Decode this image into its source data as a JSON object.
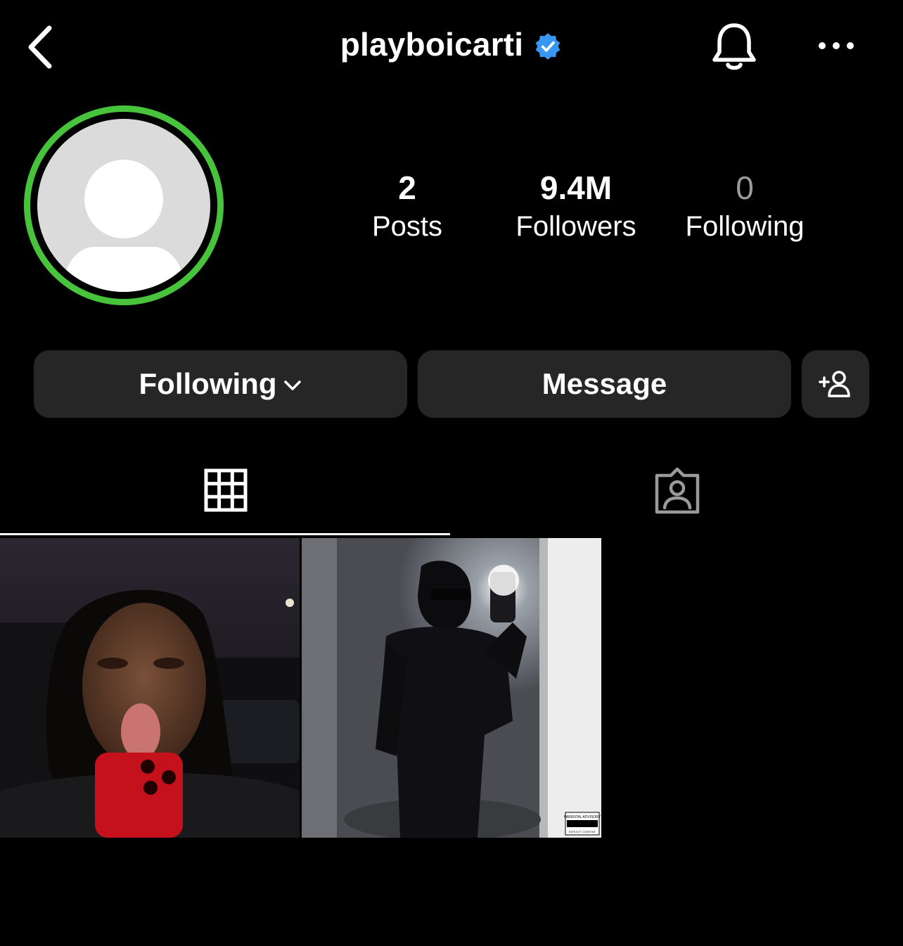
{
  "header": {
    "username": "playboicarti",
    "verified": true,
    "icons": {
      "back": "chevron-left-icon",
      "verified": "verified-badge-icon",
      "bell": "bell-icon",
      "more": "more-horizontal-icon"
    },
    "colors": {
      "verified": "#3897f0",
      "background": "#000000"
    }
  },
  "profile": {
    "avatar_ring_color": "#47c43b",
    "stats": [
      {
        "value": "2",
        "label": "Posts"
      },
      {
        "value": "9.4M",
        "label": "Followers"
      },
      {
        "value": "0",
        "label": "Following"
      }
    ]
  },
  "actions": {
    "following_label": "Following",
    "message_label": "Message",
    "icons": {
      "following_dropdown": "chevron-down-icon",
      "suggest": "add-person-icon"
    },
    "button_color": "#262626"
  },
  "tabs": [
    {
      "name": "grid",
      "icon": "grid-icon",
      "active": true
    },
    {
      "name": "tagged",
      "icon": "tagged-person-icon",
      "active": false
    }
  ],
  "posts": [
    {
      "description_icon": "photo-thumbnail"
    },
    {
      "description_icon": "photo-thumbnail",
      "badge": "PARENTAL ADVISORY",
      "badge_sub": "EXPLICIT CONTENT"
    }
  ]
}
